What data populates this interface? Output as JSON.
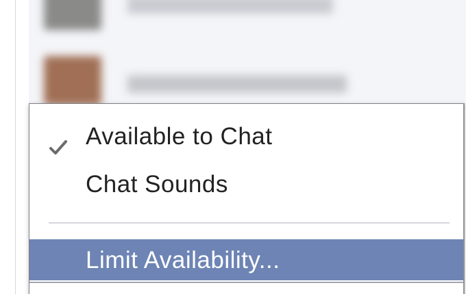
{
  "menu": {
    "items": [
      {
        "label": "Available to Chat",
        "checked": true
      },
      {
        "label": "Chat Sounds",
        "checked": false
      },
      {
        "label": "Limit Availability...",
        "highlighted": true
      }
    ]
  },
  "icons": {
    "checkmark": "check-icon"
  },
  "colors": {
    "highlight": "#6d84b4",
    "menu_text": "#222222",
    "highlight_text": "#ffffff",
    "checkmark": "#6b6b6b"
  }
}
